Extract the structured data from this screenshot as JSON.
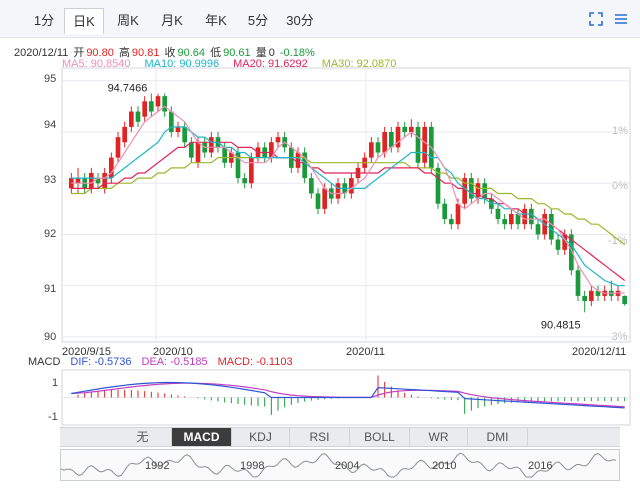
{
  "tabs": [
    {
      "label": "1分",
      "active": false
    },
    {
      "label": "日K",
      "active": true
    },
    {
      "label": "周K",
      "active": false
    },
    {
      "label": "月K",
      "active": false
    },
    {
      "label": "年K",
      "active": false
    },
    {
      "label": "5分",
      "active": false
    },
    {
      "label": "30分",
      "active": false
    }
  ],
  "toolbar": {
    "fullscreen_icon": "fullscreen-icon",
    "menu_icon": "hamburger-menu-icon"
  },
  "quote": {
    "date": "2020/12/11",
    "open_label": "开",
    "open": "90.80",
    "high_label": "高",
    "high": "90.81",
    "close_label": "收",
    "close": "90.64",
    "low_label": "低",
    "low": "90.61",
    "vol_label": "量",
    "vol": "0",
    "change": "-0.18%"
  },
  "ma": {
    "ma5": "MA5: 90.8540",
    "ma10": "MA10: 90.9996",
    "ma20": "MA20: 91.6292",
    "ma30": "MA30: 92.0870"
  },
  "colors": {
    "up": "#e02424",
    "down": "#1a9a3a",
    "ma5": "#f08fb4",
    "ma10": "#1fb6c9",
    "ma20": "#e0245a",
    "ma30": "#9ab82a",
    "dif": "#2f55d4",
    "dea": "#c43cc4",
    "grid": "#e6e9ef"
  },
  "chart_data": {
    "type": "candlestick",
    "price_axis": [
      "95",
      "94",
      "93",
      "92",
      "91",
      "90"
    ],
    "pct_axis": [
      "1%",
      "0%",
      "-1%",
      "-3%"
    ],
    "dates": [
      "2020/9/15",
      "2020/10",
      "2020/11",
      "2020/12/11"
    ],
    "annotations": {
      "high": "94.7466",
      "low": "90.4815"
    },
    "candles": [
      [
        92.9,
        93.1,
        93.2,
        92.8
      ],
      [
        93.0,
        93.1,
        93.3,
        92.8
      ],
      [
        93.1,
        92.9,
        93.2,
        92.8
      ],
      [
        92.9,
        93.2,
        93.3,
        92.8
      ],
      [
        93.1,
        93.0,
        93.2,
        92.9
      ],
      [
        92.9,
        93.2,
        93.3,
        92.8
      ],
      [
        93.1,
        93.5,
        93.6,
        93.0
      ],
      [
        93.5,
        93.9,
        94.0,
        93.4
      ],
      [
        93.8,
        94.1,
        94.2,
        93.7
      ],
      [
        94.1,
        94.4,
        94.5,
        94.0
      ],
      [
        94.4,
        94.2,
        94.5,
        94.1
      ],
      [
        94.3,
        94.6,
        94.7,
        94.2
      ],
      [
        94.6,
        94.4,
        94.75,
        94.3
      ],
      [
        94.5,
        94.7,
        94.75,
        94.4
      ],
      [
        94.7,
        94.4,
        94.75,
        94.3
      ],
      [
        94.4,
        94.0,
        94.5,
        93.9
      ],
      [
        94.0,
        94.1,
        94.2,
        93.9
      ],
      [
        94.1,
        93.8,
        94.2,
        93.7
      ],
      [
        93.8,
        93.5,
        93.9,
        93.4
      ],
      [
        93.4,
        93.8,
        93.9,
        93.3
      ],
      [
        93.8,
        93.6,
        93.9,
        93.5
      ],
      [
        93.6,
        93.9,
        94.0,
        93.5
      ],
      [
        93.9,
        93.7,
        94.0,
        93.6
      ],
      [
        93.7,
        93.4,
        93.8,
        93.3
      ],
      [
        93.4,
        93.6,
        93.7,
        93.3
      ],
      [
        93.6,
        93.1,
        93.7,
        93.0
      ],
      [
        93.1,
        93.0,
        93.2,
        92.9
      ],
      [
        93.0,
        93.5,
        93.6,
        92.9
      ],
      [
        93.5,
        93.7,
        93.8,
        93.4
      ],
      [
        93.7,
        93.5,
        93.8,
        93.4
      ],
      [
        93.5,
        93.8,
        93.9,
        93.4
      ],
      [
        93.8,
        93.9,
        94.0,
        93.7
      ],
      [
        93.9,
        93.7,
        94.0,
        93.6
      ],
      [
        93.7,
        93.3,
        93.8,
        93.2
      ],
      [
        93.3,
        93.6,
        93.7,
        93.2
      ],
      [
        93.6,
        93.1,
        93.7,
        93.0
      ],
      [
        93.1,
        92.8,
        93.2,
        92.7
      ],
      [
        92.8,
        92.5,
        92.9,
        92.4
      ],
      [
        92.5,
        92.9,
        93.0,
        92.4
      ],
      [
        92.9,
        92.7,
        93.0,
        92.6
      ],
      [
        92.7,
        93.0,
        93.1,
        92.6
      ],
      [
        93.0,
        92.8,
        93.1,
        92.7
      ],
      [
        92.8,
        93.1,
        93.2,
        92.7
      ],
      [
        93.1,
        93.3,
        93.4,
        93.0
      ],
      [
        93.3,
        93.5,
        93.6,
        93.2
      ],
      [
        93.5,
        93.8,
        93.9,
        93.4
      ],
      [
        93.8,
        93.6,
        93.9,
        93.5
      ],
      [
        93.6,
        94.0,
        94.1,
        93.5
      ],
      [
        94.0,
        93.7,
        94.1,
        93.6
      ],
      [
        93.7,
        94.1,
        94.2,
        93.6
      ],
      [
        94.1,
        94.0,
        94.2,
        93.9
      ],
      [
        94.0,
        94.1,
        94.25,
        93.9
      ],
      [
        94.1,
        93.4,
        94.2,
        93.3
      ],
      [
        93.4,
        94.1,
        94.2,
        93.3
      ],
      [
        94.1,
        93.3,
        94.2,
        93.2
      ],
      [
        93.3,
        92.6,
        93.4,
        92.5
      ],
      [
        92.6,
        92.3,
        92.7,
        92.2
      ],
      [
        92.3,
        92.2,
        92.4,
        92.1
      ],
      [
        92.2,
        92.6,
        92.7,
        92.1
      ],
      [
        92.6,
        93.1,
        93.2,
        92.5
      ],
      [
        93.1,
        92.7,
        93.2,
        92.6
      ],
      [
        92.7,
        93.0,
        93.1,
        92.6
      ],
      [
        93.0,
        92.7,
        93.1,
        92.6
      ],
      [
        92.7,
        92.5,
        92.8,
        92.4
      ],
      [
        92.5,
        92.3,
        92.6,
        92.2
      ],
      [
        92.3,
        92.2,
        92.4,
        92.1
      ],
      [
        92.2,
        92.4,
        92.5,
        92.1
      ],
      [
        92.4,
        92.2,
        92.5,
        92.1
      ],
      [
        92.2,
        92.5,
        92.6,
        92.1
      ],
      [
        92.5,
        92.2,
        92.6,
        92.1
      ],
      [
        92.2,
        92.0,
        92.3,
        91.9
      ],
      [
        92.0,
        92.4,
        92.5,
        91.9
      ],
      [
        92.4,
        91.9,
        92.5,
        91.8
      ],
      [
        91.9,
        91.7,
        92.0,
        91.6
      ],
      [
        91.7,
        92.0,
        92.1,
        91.6
      ],
      [
        92.0,
        91.3,
        92.1,
        91.2
      ],
      [
        91.3,
        90.8,
        91.4,
        90.7
      ],
      [
        90.8,
        90.7,
        90.9,
        90.48
      ],
      [
        90.7,
        90.9,
        91.0,
        90.6
      ],
      [
        90.9,
        90.8,
        91.0,
        90.7
      ],
      [
        90.8,
        90.9,
        91.0,
        90.7
      ],
      [
        90.9,
        90.8,
        91.1,
        90.7
      ],
      [
        90.8,
        90.9,
        91.0,
        90.7
      ],
      [
        90.8,
        90.64,
        90.81,
        90.61
      ]
    ],
    "ma5": [
      93.0,
      93.0,
      93.0,
      93.0,
      93.1,
      93.1,
      93.2,
      93.4,
      93.6,
      93.8,
      94.0,
      94.2,
      94.3,
      94.4,
      94.5,
      94.4,
      94.3,
      94.2,
      94.0,
      93.8,
      93.7,
      93.7,
      93.7,
      93.7,
      93.6,
      93.5,
      93.4,
      93.4,
      93.4,
      93.4,
      93.5,
      93.7,
      93.8,
      93.7,
      93.6,
      93.5,
      93.3,
      93.1,
      92.9,
      92.8,
      92.8,
      92.8,
      92.9,
      93.0,
      93.1,
      93.3,
      93.5,
      93.6,
      93.7,
      93.8,
      93.9,
      94.0,
      93.9,
      93.8,
      93.7,
      93.5,
      93.3,
      93.0,
      92.6,
      92.5,
      92.6,
      92.7,
      92.8,
      92.8,
      92.7,
      92.6,
      92.5,
      92.4,
      92.3,
      92.3,
      92.3,
      92.3,
      92.2,
      92.1,
      91.9,
      91.7,
      91.4,
      91.2,
      91.0,
      90.9,
      90.85,
      90.85,
      90.86,
      90.85
    ],
    "ma10": [
      93.1,
      93.1,
      93.1,
      93.1,
      93.1,
      93.1,
      93.1,
      93.2,
      93.3,
      93.4,
      93.5,
      93.6,
      93.7,
      93.8,
      94.0,
      94.1,
      94.1,
      94.1,
      94.0,
      93.9,
      93.9,
      93.8,
      93.8,
      93.7,
      93.7,
      93.6,
      93.6,
      93.5,
      93.5,
      93.5,
      93.5,
      93.5,
      93.5,
      93.5,
      93.5,
      93.4,
      93.3,
      93.2,
      93.1,
      93.0,
      92.9,
      92.9,
      92.9,
      92.9,
      92.9,
      93.0,
      93.1,
      93.2,
      93.3,
      93.4,
      93.5,
      93.6,
      93.6,
      93.6,
      93.5,
      93.5,
      93.3,
      93.2,
      93.0,
      92.9,
      92.8,
      92.7,
      92.7,
      92.6,
      92.6,
      92.5,
      92.5,
      92.4,
      92.4,
      92.4,
      92.3,
      92.2,
      92.1,
      92.0,
      91.9,
      91.8,
      91.6,
      91.4,
      91.3,
      91.2,
      91.1,
      91.05,
      91.0,
      91.0
    ],
    "ma20": [
      92.9,
      92.9,
      92.9,
      92.9,
      92.9,
      93.0,
      93.0,
      93.0,
      93.1,
      93.1,
      93.2,
      93.2,
      93.3,
      93.4,
      93.5,
      93.6,
      93.7,
      93.7,
      93.8,
      93.8,
      93.8,
      93.8,
      93.8,
      93.8,
      93.8,
      93.7,
      93.7,
      93.7,
      93.6,
      93.6,
      93.6,
      93.5,
      93.5,
      93.5,
      93.4,
      93.4,
      93.3,
      93.3,
      93.2,
      93.2,
      93.2,
      93.2,
      93.2,
      93.2,
      93.2,
      93.2,
      93.2,
      93.3,
      93.3,
      93.3,
      93.3,
      93.3,
      93.3,
      93.2,
      93.2,
      93.1,
      93.0,
      93.0,
      92.9,
      92.9,
      92.8,
      92.8,
      92.7,
      92.7,
      92.6,
      92.6,
      92.5,
      92.5,
      92.4,
      92.4,
      92.3,
      92.3,
      92.2,
      92.1,
      92.0,
      91.9,
      91.8,
      91.7,
      91.6,
      91.5,
      91.4,
      91.3,
      91.2,
      91.1
    ],
    "ma30": [
      92.8,
      92.8,
      92.8,
      92.9,
      92.9,
      92.9,
      92.9,
      93.0,
      93.0,
      93.0,
      93.1,
      93.1,
      93.1,
      93.2,
      93.2,
      93.3,
      93.3,
      93.3,
      93.4,
      93.4,
      93.4,
      93.4,
      93.5,
      93.5,
      93.5,
      93.5,
      93.5,
      93.5,
      93.5,
      93.5,
      93.5,
      93.5,
      93.5,
      93.5,
      93.5,
      93.5,
      93.4,
      93.4,
      93.4,
      93.4,
      93.4,
      93.4,
      93.4,
      93.4,
      93.4,
      93.4,
      93.4,
      93.4,
      93.4,
      93.4,
      93.4,
      93.3,
      93.3,
      93.3,
      93.3,
      93.2,
      93.2,
      93.1,
      93.1,
      93.0,
      93.0,
      92.9,
      92.9,
      92.9,
      92.8,
      92.8,
      92.8,
      92.7,
      92.7,
      92.7,
      92.6,
      92.6,
      92.5,
      92.5,
      92.4,
      92.4,
      92.3,
      92.3,
      92.2,
      92.2,
      92.1,
      92.0,
      91.9,
      91.8
    ]
  },
  "macd": {
    "label": "MACD",
    "dif": "DIF: -0.5736",
    "dea": "DEA: -0.5185",
    "macd": "MACD: -0.1103",
    "axis": [
      "1",
      "-1"
    ]
  },
  "indicators": [
    {
      "label": "无",
      "active": false
    },
    {
      "label": "MACD",
      "active": true
    },
    {
      "label": "KDJ",
      "active": false
    },
    {
      "label": "RSI",
      "active": false
    },
    {
      "label": "BOLL",
      "active": false
    },
    {
      "label": "WR",
      "active": false
    },
    {
      "label": "DMI",
      "active": false
    }
  ],
  "navigator": {
    "years": [
      "1992",
      "1998",
      "2004",
      "2010",
      "2016"
    ],
    "up_arrow": "▲",
    "down_arrow": "▼"
  }
}
